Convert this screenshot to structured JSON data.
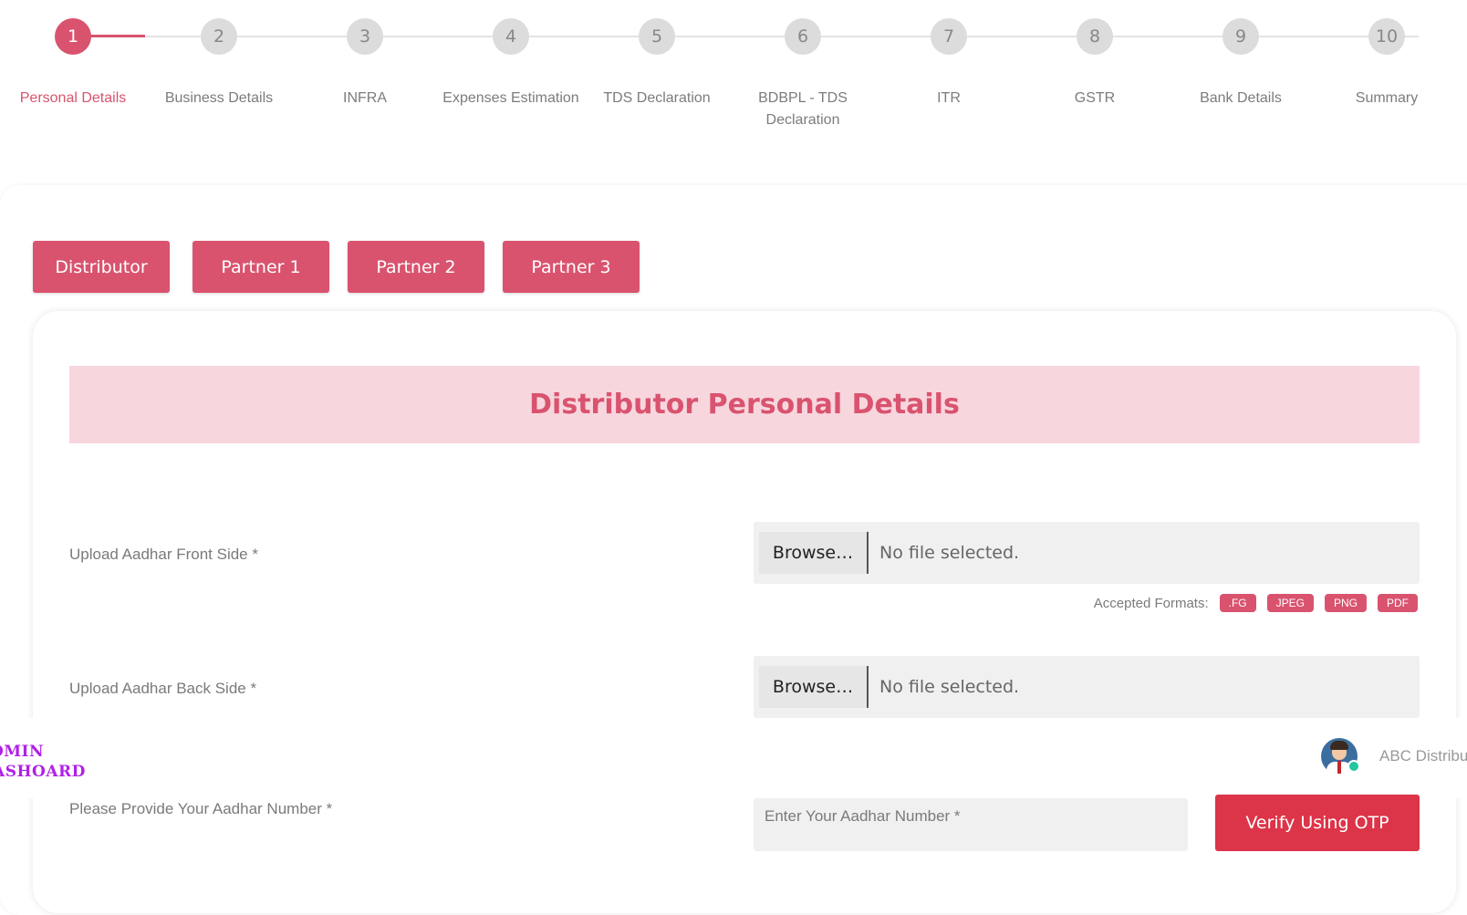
{
  "stepper": {
    "active_step": 1,
    "steps": [
      {
        "number": "1",
        "label": "Personal Details"
      },
      {
        "number": "2",
        "label": "Business Details"
      },
      {
        "number": "3",
        "label": "INFRA"
      },
      {
        "number": "4",
        "label": "Expenses Estimation"
      },
      {
        "number": "5",
        "label": "TDS Declaration"
      },
      {
        "number": "6",
        "label": "BDBPL - TDS Declaration"
      },
      {
        "number": "7",
        "label": "ITR"
      },
      {
        "number": "8",
        "label": "GSTR"
      },
      {
        "number": "9",
        "label": "Bank Details"
      },
      {
        "number": "10",
        "label": "Summary"
      }
    ]
  },
  "tabs": {
    "distributor": "Distributor",
    "partner1": "Partner 1",
    "partner2": "Partner 2",
    "partner3": "Partner 3"
  },
  "form": {
    "title": "Distributor Personal Details",
    "aadhar_front": {
      "label": "Upload Aadhar Front Side *",
      "browse": "Browse…",
      "status": "No file selected."
    },
    "accepted_formats": {
      "label": "Accepted Formats:",
      "formats": [
        ".FG",
        "JPEG",
        "PNG",
        "PDF"
      ]
    },
    "aadhar_back": {
      "label": "Upload Aadhar Back Side *",
      "browse": "Browse…",
      "status": "No file selected."
    },
    "aadhar_number": {
      "label": "Please Provide Your Aadhar Number *",
      "placeholder": "Enter Your Aadhar Number *",
      "verify_button": "Verify Using OTP"
    }
  },
  "topbar": {
    "logo_line1": "DMIN",
    "logo_line2": "ASHOARD",
    "user_name": "ABC Distributor",
    "avatar_icon": "user-avatar-icon",
    "online_status_color": "#22c7a0"
  },
  "colors": {
    "accent": "#d9536f",
    "header_bg": "#f7d6de",
    "otp_button": "#dc3448",
    "logo": "#b020e8"
  }
}
